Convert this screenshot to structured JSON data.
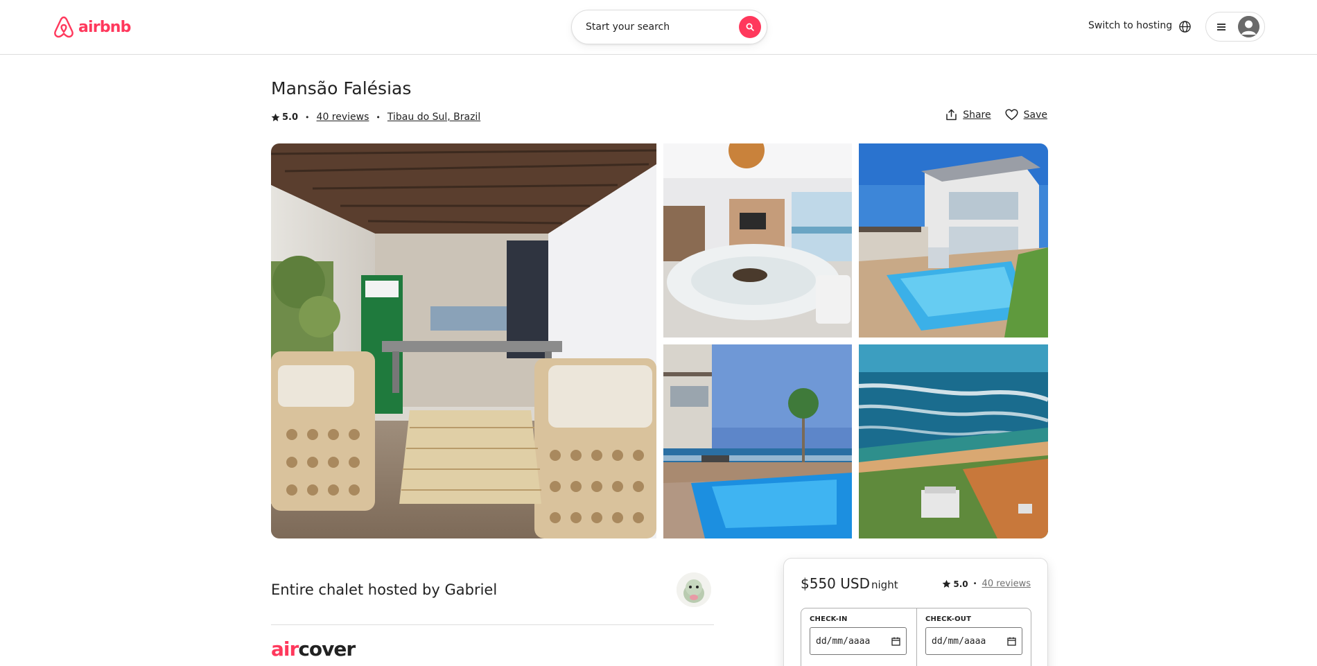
{
  "header": {
    "logo_text": "airbnb",
    "search_placeholder": "Start your search",
    "switch_hosting": "Switch to hosting"
  },
  "listing": {
    "title": "Mansão Falésias",
    "rating": "5.0",
    "reviews": "40 reviews",
    "location": "Tibau do Sul, Brazil",
    "share_label": "Share",
    "save_label": "Save"
  },
  "host": {
    "hosted_by": "Entire chalet hosted by Gabriel"
  },
  "aircover": {
    "air": "air",
    "cover": "cover"
  },
  "booking": {
    "price": "$550 USD",
    "price_unit": "night",
    "rating": "5.0",
    "reviews": "40 reviews",
    "checkin_label": "CHECK-IN",
    "checkout_label": "CHECK-OUT",
    "checkin_value": "dd/mm/aaaa",
    "checkout_value": "dd/mm/aaaa"
  },
  "colors": {
    "brand": "#ff385c",
    "text": "#222222",
    "border": "#dddddd"
  },
  "icons": [
    "airbnb-logo-icon",
    "search-icon",
    "globe-icon",
    "hamburger-menu-icon",
    "user-avatar-icon",
    "star-icon",
    "share-icon",
    "heart-icon",
    "calendar-icon"
  ]
}
